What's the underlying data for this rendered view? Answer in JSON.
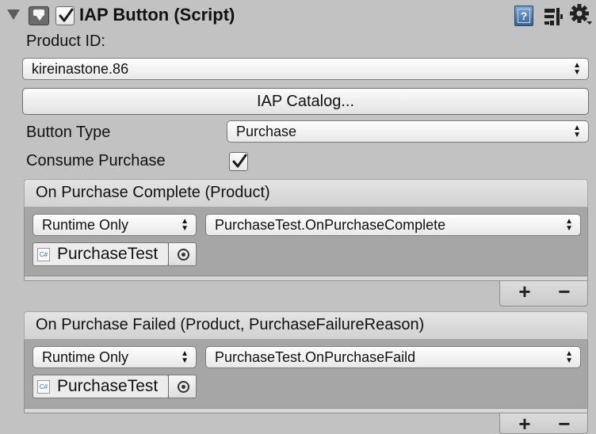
{
  "component": {
    "title": "IAP Button (Script)",
    "enabled": true
  },
  "fields": {
    "product_id_label": "Product ID:",
    "product_id_value": "kireinastone.86",
    "catalog_button": "IAP Catalog...",
    "button_type_label": "Button Type",
    "button_type_value": "Purchase",
    "consume_purchase_label": "Consume Purchase",
    "consume_purchase_checked": true
  },
  "events": [
    {
      "header": "On Purchase Complete (Product)",
      "mode": "Runtime Only",
      "function": "PurchaseTest.OnPurchaseComplete",
      "object": "PurchaseTest"
    },
    {
      "header": "On Purchase Failed (Product, PurchaseFailureReason)",
      "mode": "Runtime Only",
      "function": "PurchaseTest.OnPurchaseFaild",
      "object": "PurchaseTest"
    }
  ],
  "icons": {
    "foldout": "foldout-triangle-icon",
    "component": "iap-button-component-icon",
    "help": "help-book-icon",
    "presets": "presets-icon",
    "settings": "gear-icon",
    "script": "csharp-script-icon",
    "object_picker": "object-picker-icon"
  },
  "list_controls": {
    "add": "+",
    "remove": "−"
  },
  "colors": {
    "background": "#c2c2c2",
    "event_body": "#a6a6a6",
    "help_icon": "#4a74a8"
  }
}
